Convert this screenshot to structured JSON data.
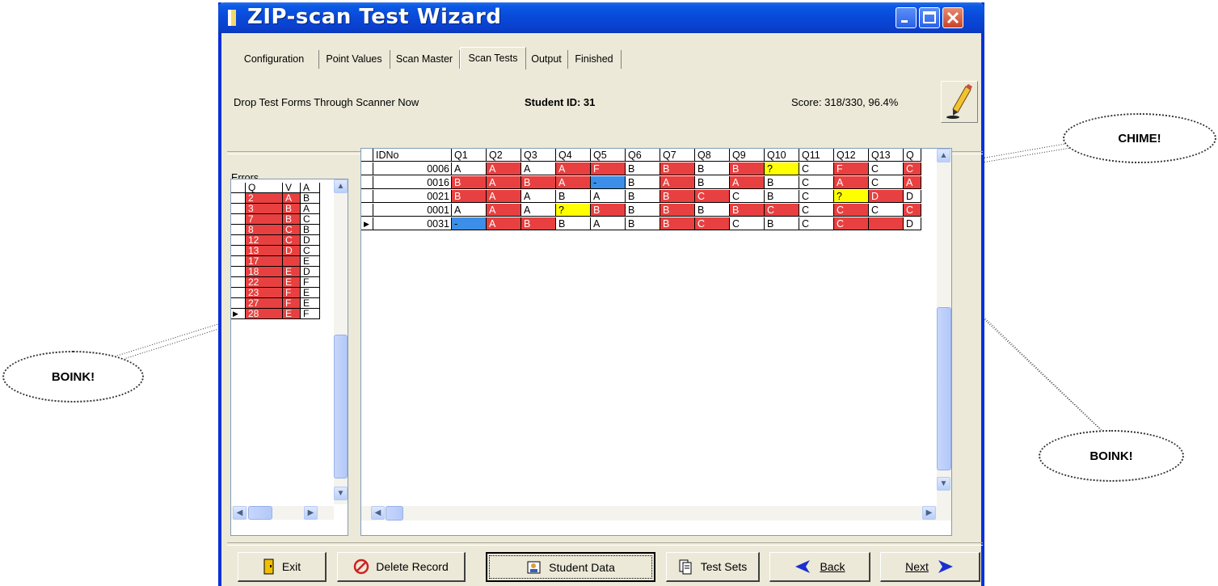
{
  "window": {
    "title": "ZIP-scan Test Wizard"
  },
  "tabs": [
    "Configuration",
    "Point Values",
    "Scan Master",
    "Scan Tests",
    "Output",
    "Finished"
  ],
  "active_tab": "Scan Tests",
  "status": {
    "message": "Drop Test Forms Through Scanner Now",
    "student_id": "Student ID: 31",
    "score": "Score: 318/330, 96.4%"
  },
  "errors": {
    "label": "Errors",
    "headers": [
      "Q",
      "V",
      "A"
    ],
    "rows": [
      [
        "2",
        "A",
        "B"
      ],
      [
        "3",
        "B",
        "A"
      ],
      [
        "7",
        "B",
        "C"
      ],
      [
        "8",
        "C",
        "B"
      ],
      [
        "12",
        "C",
        "D"
      ],
      [
        "13",
        "D",
        "C"
      ],
      [
        "17",
        "",
        "E"
      ],
      [
        "18",
        "E",
        "D"
      ],
      [
        "22",
        "E",
        "F"
      ],
      [
        "23",
        "F",
        "E"
      ],
      [
        "27",
        "F",
        "E"
      ],
      [
        "28",
        "E",
        "F"
      ]
    ]
  },
  "grid": {
    "headers": [
      "IDNo",
      "Q1",
      "Q2",
      "Q3",
      "Q4",
      "Q5",
      "Q6",
      "Q7",
      "Q8",
      "Q9",
      "Q10",
      "Q11",
      "Q12",
      "Q13",
      "Q"
    ],
    "rows": [
      {
        "id": "0006",
        "cells": [
          [
            "A",
            ""
          ],
          [
            "A",
            "r"
          ],
          [
            "A",
            ""
          ],
          [
            "A",
            "r"
          ],
          [
            "F",
            "r"
          ],
          [
            "B",
            ""
          ],
          [
            "B",
            "r"
          ],
          [
            "B",
            ""
          ],
          [
            "B",
            "r"
          ],
          [
            "?",
            "y"
          ],
          [
            "C",
            ""
          ],
          [
            "F",
            "r"
          ],
          [
            "C",
            ""
          ],
          [
            "C",
            "r"
          ]
        ]
      },
      {
        "id": "0016",
        "cells": [
          [
            "B",
            "r"
          ],
          [
            "A",
            "r"
          ],
          [
            "B",
            "r"
          ],
          [
            "A",
            "r"
          ],
          [
            "-",
            "b"
          ],
          [
            "B",
            ""
          ],
          [
            "A",
            "r"
          ],
          [
            "B",
            ""
          ],
          [
            "A",
            "r"
          ],
          [
            "B",
            ""
          ],
          [
            "C",
            ""
          ],
          [
            "A",
            "r"
          ],
          [
            "C",
            ""
          ],
          [
            "A",
            "r"
          ]
        ]
      },
      {
        "id": "0021",
        "cells": [
          [
            "B",
            "r"
          ],
          [
            "A",
            "r"
          ],
          [
            "A",
            ""
          ],
          [
            "B",
            ""
          ],
          [
            "A",
            ""
          ],
          [
            "B",
            ""
          ],
          [
            "B",
            "r"
          ],
          [
            "C",
            "r"
          ],
          [
            "C",
            ""
          ],
          [
            "B",
            ""
          ],
          [
            "C",
            ""
          ],
          [
            "?",
            "y"
          ],
          [
            "D",
            "r"
          ],
          [
            "D",
            ""
          ]
        ]
      },
      {
        "id": "0001",
        "cells": [
          [
            "A",
            ""
          ],
          [
            "A",
            "r"
          ],
          [
            "A",
            ""
          ],
          [
            "?",
            "y"
          ],
          [
            "B",
            "r"
          ],
          [
            "B",
            ""
          ],
          [
            "B",
            "r"
          ],
          [
            "B",
            ""
          ],
          [
            "B",
            "r"
          ],
          [
            "C",
            "r"
          ],
          [
            "C",
            ""
          ],
          [
            "C",
            "r"
          ],
          [
            "C",
            ""
          ],
          [
            "C",
            "r"
          ]
        ]
      },
      {
        "id": "0031",
        "cells": [
          [
            "-",
            "b"
          ],
          [
            "A",
            "r"
          ],
          [
            "B",
            "r"
          ],
          [
            "B",
            ""
          ],
          [
            "A",
            ""
          ],
          [
            "B",
            ""
          ],
          [
            "B",
            "r"
          ],
          [
            "C",
            "r"
          ],
          [
            "C",
            ""
          ],
          [
            "B",
            ""
          ],
          [
            "C",
            ""
          ],
          [
            "C",
            "r"
          ],
          [
            "",
            "r"
          ],
          [
            "D",
            ""
          ]
        ]
      }
    ],
    "current_row": 4
  },
  "buttons": {
    "exit": "Exit",
    "delete": "Delete Record",
    "student_data": "Student Data",
    "test_sets": "Test Sets",
    "back": "Back",
    "next": "Next"
  },
  "callouts": {
    "chime": "CHIME!",
    "boink_left": "BOINK!",
    "boink_right": "BOINK!"
  },
  "colors": {
    "wrong": "#e84040",
    "uncertain": "#ffff00",
    "blank": "#3b8fe8",
    "title_bar": "#0a48d8"
  }
}
